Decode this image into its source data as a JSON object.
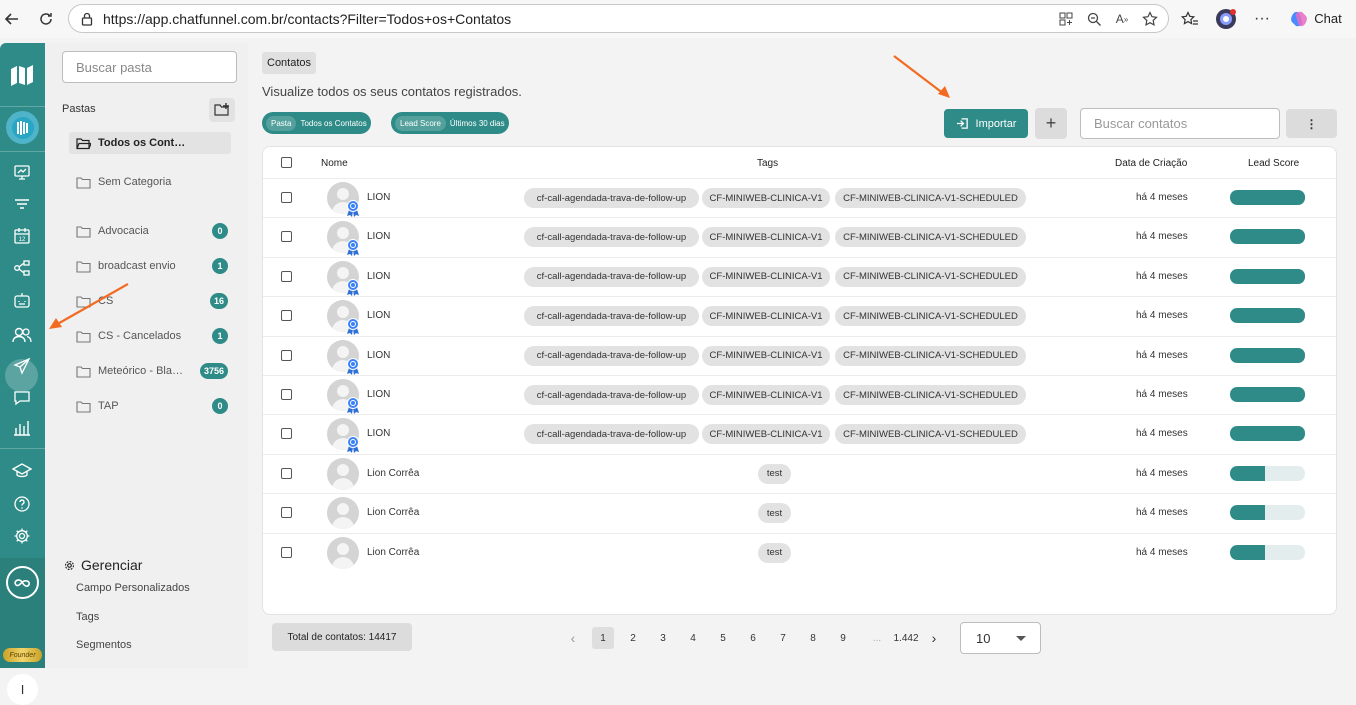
{
  "browser": {
    "url": "https://app.chatfunnel.com.br/contacts?Filter=Todos+os+Contatos",
    "chat_label": "Chat"
  },
  "folders_panel": {
    "search_placeholder": "Buscar pasta",
    "section_label": "Pastas",
    "items": [
      {
        "name": "Todos os Contatos",
        "count": null
      },
      {
        "name": "Sem Categoria",
        "count": null
      },
      {
        "name": "Advocacia",
        "count": "0"
      },
      {
        "name": "broadcast envio",
        "count": "1"
      },
      {
        "name": "CS",
        "count": "16"
      },
      {
        "name": "CS - Cancelados",
        "count": "1"
      },
      {
        "name": "Meteórico - Black...",
        "count": "3756"
      },
      {
        "name": "TAP",
        "count": "0"
      }
    ],
    "manage": {
      "title": "Gerenciar",
      "links": [
        "Campo Personalizados",
        "Tags",
        "Segmentos"
      ]
    }
  },
  "rail": {
    "founder_label": "Founder",
    "user_initial": "I"
  },
  "main": {
    "breadcrumb": "Contatos",
    "subtitle": "Visualize todos os seus contatos registrados.",
    "filters": [
      {
        "key": "Pasta",
        "value": "Todos os Contatos"
      },
      {
        "key": "Lead Score",
        "value": "Últimos 30 dias"
      }
    ],
    "import_label": "Importar",
    "add_label": "+",
    "search_placeholder": "Buscar contatos",
    "more_label": "⋮",
    "table": {
      "columns": [
        "Nome",
        "Tags",
        "Data de Criação",
        "Lead Score"
      ],
      "rows": [
        {
          "name": "LION",
          "tags": [
            "cf-call-agendada-trava-de-follow-up",
            "CF-MINIWEB-CLINICA-V1",
            "CF-MINIWEB-CLINICA-V1-SCHEDULED"
          ],
          "date": "há 4 meses",
          "score": 1.0,
          "badge": true
        },
        {
          "name": "LION",
          "tags": [
            "cf-call-agendada-trava-de-follow-up",
            "CF-MINIWEB-CLINICA-V1",
            "CF-MINIWEB-CLINICA-V1-SCHEDULED"
          ],
          "date": "há 4 meses",
          "score": 1.0,
          "badge": true
        },
        {
          "name": "LION",
          "tags": [
            "cf-call-agendada-trava-de-follow-up",
            "CF-MINIWEB-CLINICA-V1",
            "CF-MINIWEB-CLINICA-V1-SCHEDULED"
          ],
          "date": "há 4 meses",
          "score": 1.0,
          "badge": true
        },
        {
          "name": "LION",
          "tags": [
            "cf-call-agendada-trava-de-follow-up",
            "CF-MINIWEB-CLINICA-V1",
            "CF-MINIWEB-CLINICA-V1-SCHEDULED"
          ],
          "date": "há 4 meses",
          "score": 1.0,
          "badge": true
        },
        {
          "name": "LION",
          "tags": [
            "cf-call-agendada-trava-de-follow-up",
            "CF-MINIWEB-CLINICA-V1",
            "CF-MINIWEB-CLINICA-V1-SCHEDULED"
          ],
          "date": "há 4 meses",
          "score": 1.0,
          "badge": true
        },
        {
          "name": "LION",
          "tags": [
            "cf-call-agendada-trava-de-follow-up",
            "CF-MINIWEB-CLINICA-V1",
            "CF-MINIWEB-CLINICA-V1-SCHEDULED"
          ],
          "date": "há 4 meses",
          "score": 1.0,
          "badge": true
        },
        {
          "name": "LION",
          "tags": [
            "cf-call-agendada-trava-de-follow-up",
            "CF-MINIWEB-CLINICA-V1",
            "CF-MINIWEB-CLINICA-V1-SCHEDULED"
          ],
          "date": "há 4 meses",
          "score": 1.0,
          "badge": true
        },
        {
          "name": "Lion Corrêa",
          "tags": [
            "test"
          ],
          "date": "há 4 meses",
          "score": 0.47,
          "badge": false
        },
        {
          "name": "Lion Corrêa",
          "tags": [
            "test"
          ],
          "date": "há 4 meses",
          "score": 0.47,
          "badge": false
        },
        {
          "name": "Lion Corrêa",
          "tags": [
            "test"
          ],
          "date": "há 4 meses",
          "score": 0.47,
          "badge": false
        }
      ]
    },
    "total_label": "Total de contatos: 14417",
    "pagination": {
      "prev": "‹",
      "pages": [
        "1",
        "2",
        "3",
        "4",
        "5",
        "6",
        "7",
        "8",
        "9",
        "...",
        "1.442"
      ],
      "next": "›",
      "current": "1"
    },
    "page_size": "10"
  },
  "colors": {
    "accent": "#2e8b87",
    "annotation_arrow": "#f26b21"
  }
}
